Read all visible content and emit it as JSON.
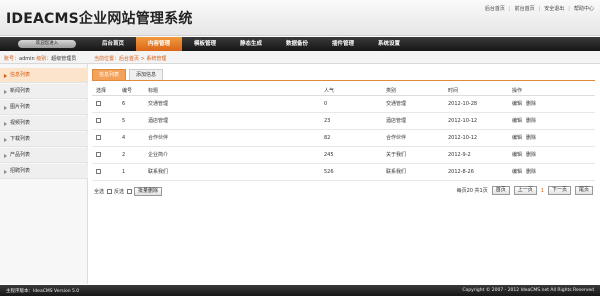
{
  "header": {
    "logo": "IDEACMS企业网站管理系统",
    "links": [
      "后台首页",
      "前台首页",
      "安全退出",
      "帮助中心"
    ]
  },
  "nav": {
    "welcome": "欢迎您进入",
    "items": [
      "后台首页",
      "内容管理",
      "模板管理",
      "静态生成",
      "数据备份",
      "插件管理",
      "系统设置"
    ],
    "active_index": 1
  },
  "subbar": {
    "user_label": "账号：",
    "user_value": "admin",
    "level_label": "级别：",
    "level_value": "超级管理员",
    "breadcrumb": "当前位置：后台首页 > 系统管理"
  },
  "sidebar": {
    "items": [
      "信息列表",
      "新闻列表",
      "图片列表",
      "视频列表",
      "下载列表",
      "产品列表",
      "招聘列表"
    ],
    "active_index": 0
  },
  "tabs": [
    "信息列表",
    "添加信息"
  ],
  "table": {
    "headers": [
      "选择",
      "编号",
      "标题",
      "人气",
      "类别",
      "时间",
      "操作"
    ],
    "rows": [
      {
        "id": "6",
        "title": "交通管理",
        "views": "0",
        "category": "交通管理",
        "time": "2012-10-28",
        "edit": "编辑",
        "del": "删除"
      },
      {
        "id": "5",
        "title": "酒店管理",
        "views": "23",
        "category": "酒店管理",
        "time": "2012-10-12",
        "edit": "编辑",
        "del": "删除"
      },
      {
        "id": "4",
        "title": "合作伙伴",
        "views": "82",
        "category": "合作伙伴",
        "time": "2012-10-12",
        "edit": "编辑",
        "del": "删除"
      },
      {
        "id": "2",
        "title": "企业简介",
        "views": "245",
        "category": "关于我们",
        "time": "2012-9-2",
        "edit": "编辑",
        "del": "删除"
      },
      {
        "id": "1",
        "title": "联系我们",
        "views": "526",
        "category": "联系我们",
        "time": "2012-8-26",
        "edit": "编辑",
        "del": "删除"
      }
    ]
  },
  "bulk": {
    "select_all": "全选",
    "invert": "反选",
    "delete_button": "批量删除"
  },
  "pager": {
    "summary": "每页20 共1页",
    "first": "首页",
    "prev": "上一页",
    "current": "1",
    "next": "下一页",
    "last": "尾页"
  },
  "footer": {
    "version": "主程序版本：IdeaCMS Version 5.0",
    "copyright": "Copyright © 2007 - 2012 IdeaCMS.net All Rights Reserved"
  }
}
